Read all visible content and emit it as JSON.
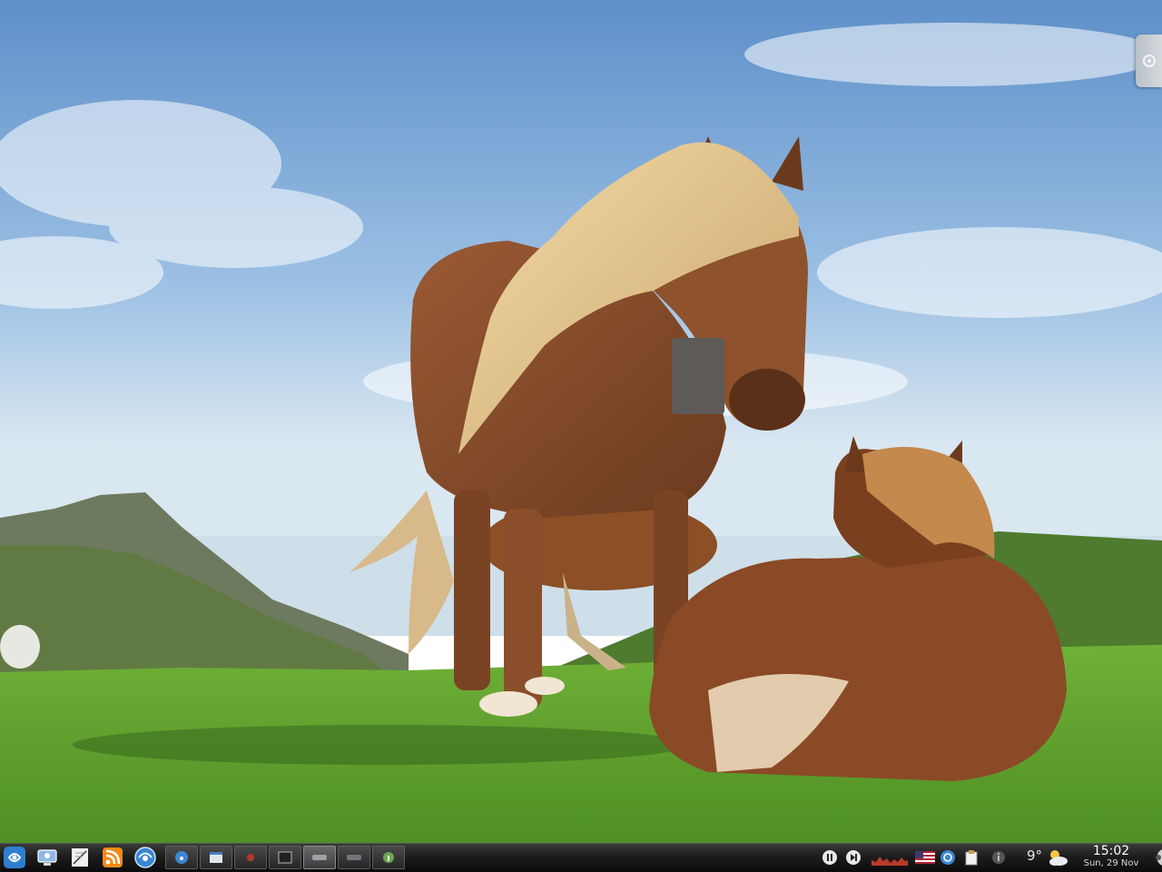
{
  "wallpaper": {
    "icon": "horses-landscape-wallpaper",
    "colors": {
      "sky": "#8fb6dd",
      "grass": "#5fa02e",
      "horse": "#8a4e2a",
      "mane": "#e8cf9a"
    }
  },
  "panel": {
    "launcher_icons": [
      "application-menu-icon",
      "system-settings-icon",
      "notes-icon",
      "rss-feed-icon",
      "web-browser-icon"
    ],
    "tasks": [
      {
        "icon": "web-browser-icon",
        "active": false
      },
      {
        "icon": "document-window-icon",
        "active": false
      },
      {
        "icon": "media-window-icon",
        "active": false
      },
      {
        "icon": "terminal-window-icon",
        "active": false
      },
      {
        "icon": "dialog-window-icon",
        "active": true
      },
      {
        "icon": "blank-window-icon",
        "active": false
      },
      {
        "icon": "info-window-icon",
        "active": false
      }
    ],
    "tray": {
      "icons": [
        "pause-icon",
        "next-track-icon",
        "system-monitor-graph",
        "us-flag-keyboard-layout-icon",
        "network-icon",
        "clipboard-icon",
        "info-icon",
        "weather-icon"
      ],
      "temperature": "9°",
      "clock_time": "15:02",
      "clock_date": "Sun, 29 Nov"
    }
  }
}
